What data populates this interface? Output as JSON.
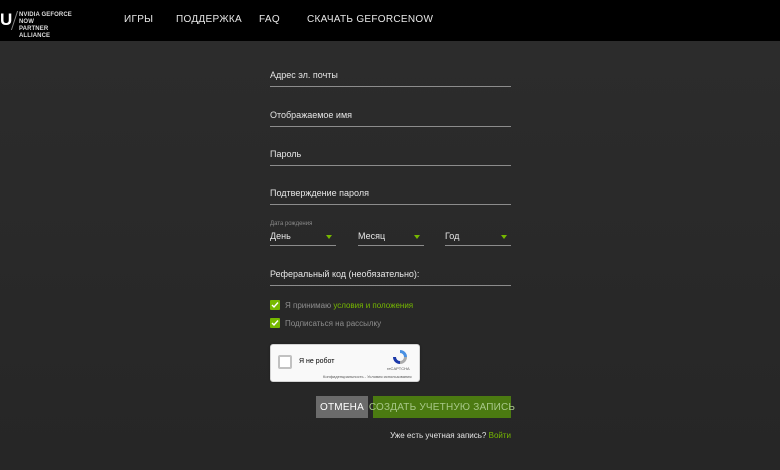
{
  "header": {
    "logo_mark": "U",
    "logo_text_line1": "NVIDIA GEFORCE NOW",
    "logo_text_line2": "PARTNER ALLIANCE",
    "nav": [
      {
        "label": "ИГРЫ"
      },
      {
        "label": "ПОДДЕРЖКА"
      },
      {
        "label": "FAQ"
      },
      {
        "label": "СКАЧАТЬ GEFORCENOW"
      }
    ]
  },
  "form": {
    "email_label": "Адрес эл. почты",
    "display_name_label": "Отображаемое имя",
    "password_label": "Пароль",
    "password_confirm_label": "Подтверждение пароля",
    "dob_caption": "Дата рождения",
    "dob_day": "День",
    "dob_month": "Месяц",
    "dob_year": "Год",
    "referral_label": "Реферальный код (необязательно):",
    "accept_prefix": "Я принимаю ",
    "accept_link": "условия и положения",
    "newsletter_label": "Подписаться на рассылку",
    "recaptcha_label": "Я не робот",
    "recaptcha_brand": "reCAPTCHA",
    "recaptcha_terms": "Конфиденциальность - Условия использования",
    "cancel_button": "ОТМЕНА",
    "create_button": "СОЗДАТЬ УЧЕТНУЮ ЗАПИСЬ",
    "have_account": "Уже есть учетная запись? ",
    "login_link": "Войти"
  },
  "colors": {
    "accent": "#76b900",
    "background": "#2b2b2b",
    "header": "#000000"
  }
}
